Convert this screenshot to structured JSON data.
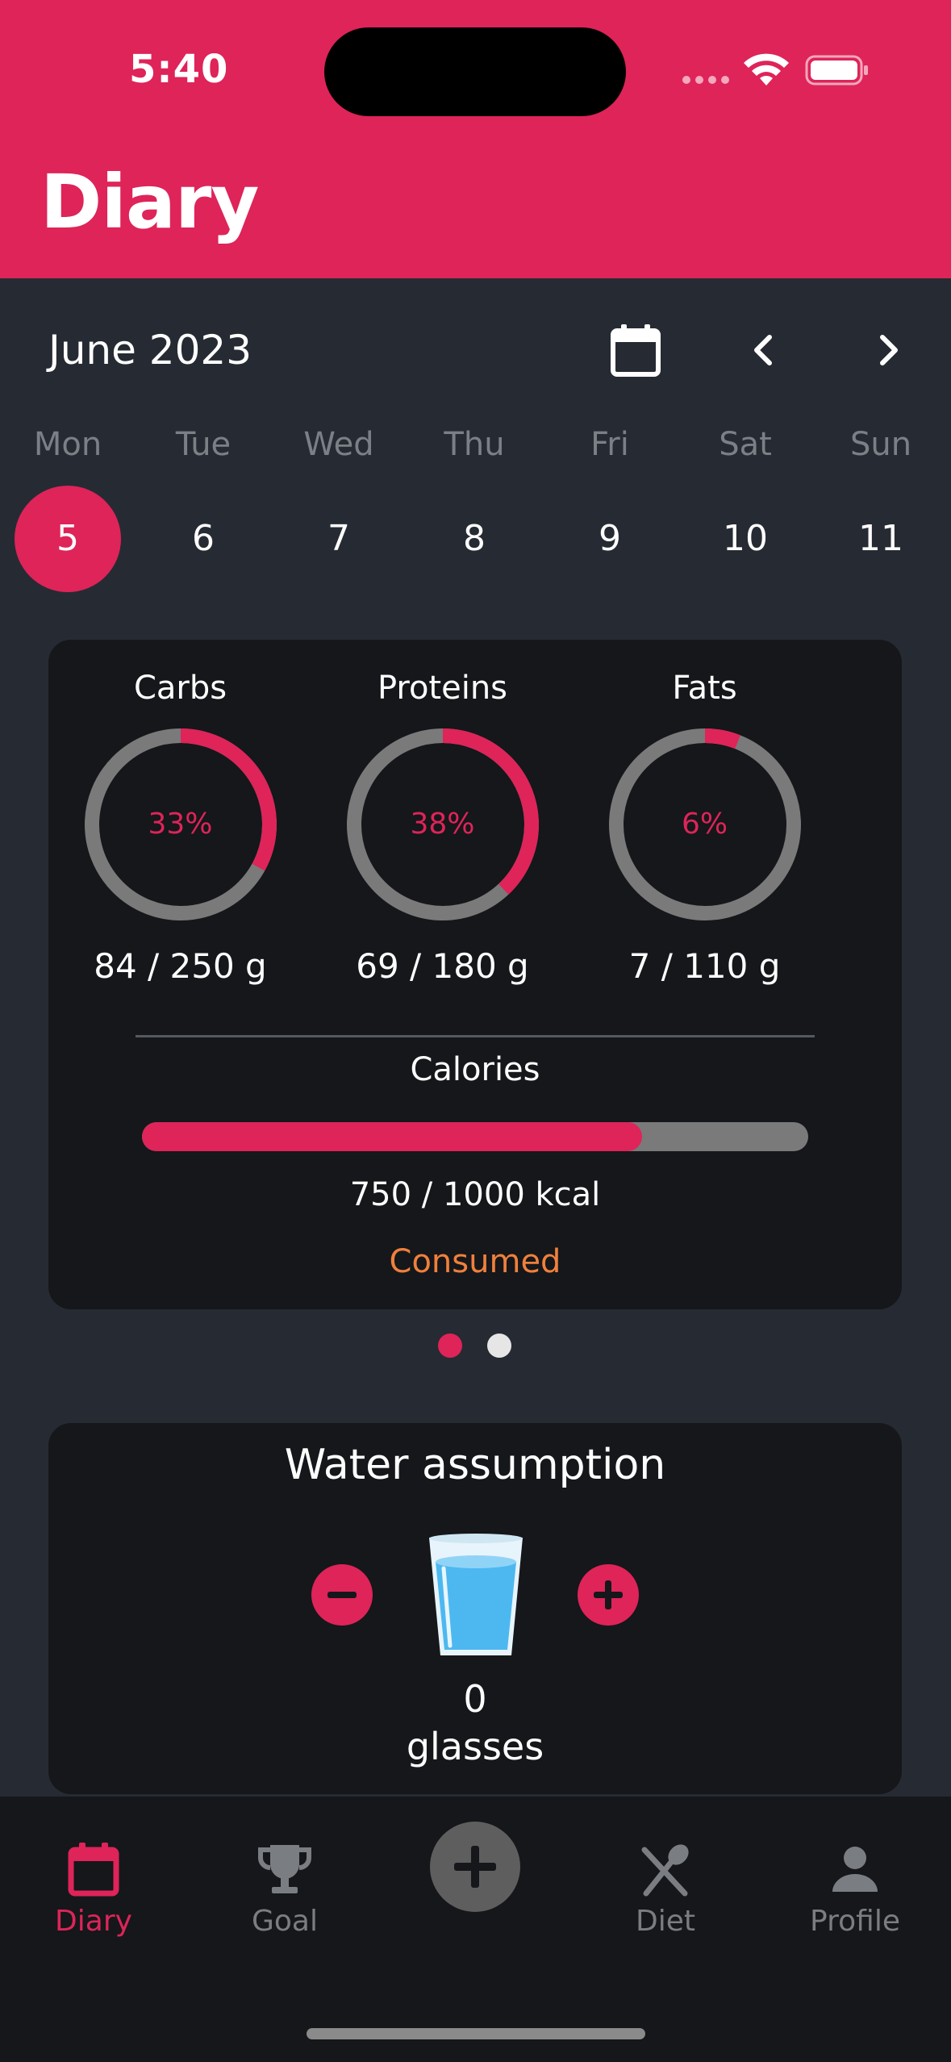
{
  "status_bar": {
    "time": "5:40"
  },
  "header": {
    "title": "Diary"
  },
  "calendar": {
    "month": "June 2023",
    "days": [
      {
        "name": "Mon",
        "num": "5",
        "selected": true
      },
      {
        "name": "Tue",
        "num": "6",
        "selected": false
      },
      {
        "name": "Wed",
        "num": "7",
        "selected": false
      },
      {
        "name": "Thu",
        "num": "8",
        "selected": false
      },
      {
        "name": "Fri",
        "num": "9",
        "selected": false
      },
      {
        "name": "Sat",
        "num": "10",
        "selected": false
      },
      {
        "name": "Sun",
        "num": "11",
        "selected": false
      }
    ]
  },
  "macros": [
    {
      "name": "Carbs",
      "percent": "33%",
      "fraction": 0.33,
      "amount": "84 / 250 g"
    },
    {
      "name": "Proteins",
      "percent": "38%",
      "fraction": 0.38,
      "amount": "69 / 180 g"
    },
    {
      "name": "Fats",
      "percent": "6%",
      "fraction": 0.06,
      "amount": "7 / 110 g"
    }
  ],
  "calories": {
    "label": "Calories",
    "fraction": 0.75,
    "amount": "750 / 1000 kcal",
    "status": "Consumed"
  },
  "pager": {
    "active_index": 0,
    "count": 2
  },
  "water": {
    "title": "Water assumption",
    "count": "0",
    "unit": "glasses"
  },
  "tabs": [
    {
      "label": "Diary",
      "icon": "calendar-icon",
      "active": true
    },
    {
      "label": "Goal",
      "icon": "trophy-icon",
      "active": false
    },
    {
      "label": "Diet",
      "icon": "fork-spoon-icon",
      "active": false
    },
    {
      "label": "Profile",
      "icon": "person-icon",
      "active": false
    }
  ],
  "colors": {
    "accent": "#de2459",
    "background": "#262b33",
    "card": "#15171a",
    "ring_track": "#7a7a7a",
    "consumed": "#f0803c"
  }
}
